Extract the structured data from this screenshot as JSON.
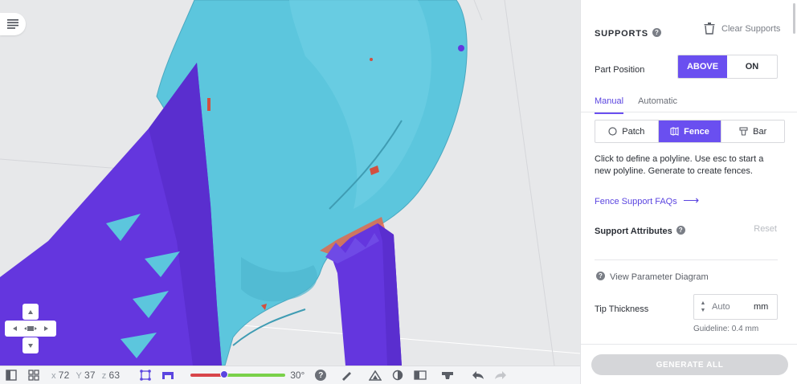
{
  "viewport": {
    "coords": {
      "x_label": "x",
      "x_value": "72",
      "y_label": "Y",
      "y_value": "37",
      "z_label": "z",
      "z_value": "63"
    },
    "angle": "30°",
    "overhang_fraction": 0.35,
    "colors": {
      "model": "#5cc6dd",
      "support": "#6436de",
      "overhang": "#e2674b",
      "background": "#e7e8ea"
    }
  },
  "toolbar": {
    "icons": [
      "panel-layout-icon",
      "grid-view-icon",
      "fit-view-icon",
      "support-view-icon",
      "help-icon",
      "measure-icon",
      "triangle-icon",
      "contrast-icon",
      "layout-icon",
      "base-icon",
      "undo-icon",
      "redo-icon"
    ],
    "help_glyph": "?"
  },
  "panel": {
    "title": "SUPPORTS",
    "help_glyph": "?",
    "clear_label": "Clear Supports",
    "part_position_label": "Part Position",
    "position_options": [
      "ABOVE",
      "ON"
    ],
    "tabs": [
      "Manual",
      "Automatic"
    ],
    "types": [
      "Patch",
      "Fence",
      "Bar"
    ],
    "description": "Click to define a polyline. Use esc to start a new polyline. Generate to create fences.",
    "faq_link": "Fence Support FAQs",
    "faq_arrow": "⟶",
    "attributes_label": "Support Attributes",
    "reset_label": "Reset",
    "parameter_diagram": "View Parameter Diagram",
    "tip_thickness_label": "Tip Thickness",
    "tip_thickness_placeholder": "Auto",
    "tip_thickness_unit": "mm",
    "guideline": "Guideline: 0.4 mm",
    "generate_label": "GENERATE ALL",
    "accent": "#6a4ff0"
  }
}
